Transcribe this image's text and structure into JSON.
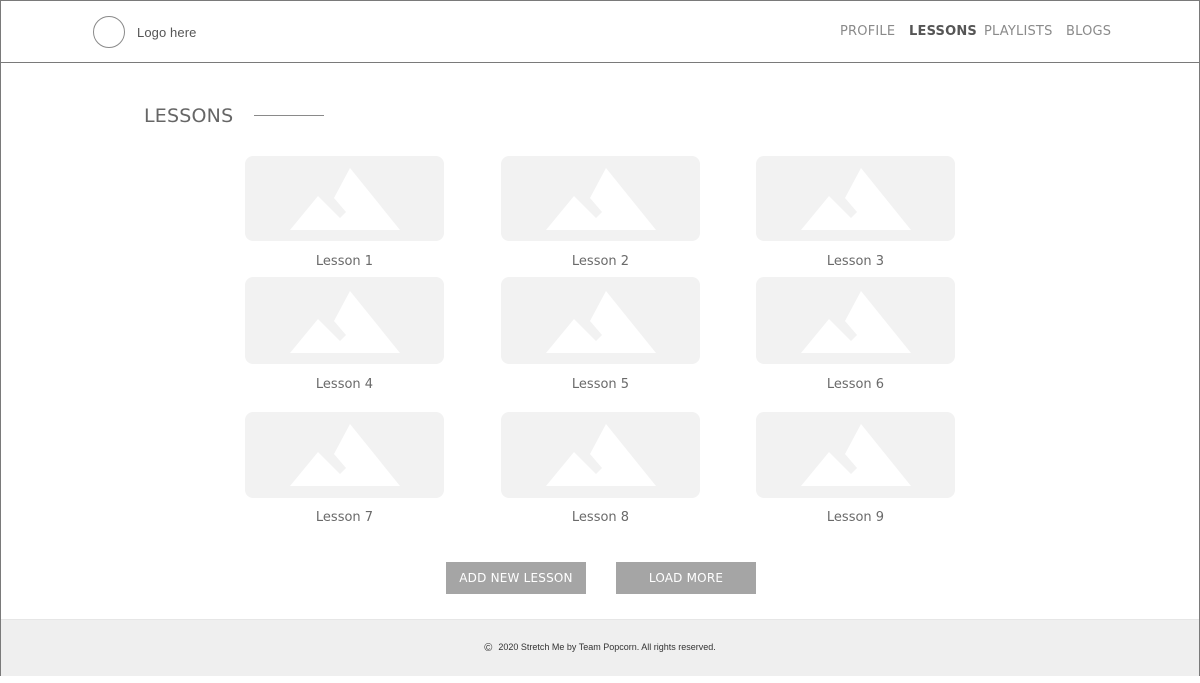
{
  "header": {
    "logo_text": "Logo here",
    "nav": [
      {
        "label": "PROFILE",
        "active": false
      },
      {
        "label": "LESSONS",
        "active": true
      },
      {
        "label": "PLAYLISTS",
        "active": false
      },
      {
        "label": "BLOGS",
        "active": false
      }
    ]
  },
  "main": {
    "title": "LESSONS",
    "lessons": [
      {
        "label": "Lesson 1"
      },
      {
        "label": "Lesson 2"
      },
      {
        "label": "Lesson 3"
      },
      {
        "label": "Lesson 4"
      },
      {
        "label": "Lesson 5"
      },
      {
        "label": "Lesson 6"
      },
      {
        "label": "Lesson 7"
      },
      {
        "label": "Lesson 8"
      },
      {
        "label": "Lesson 9"
      }
    ],
    "add_button": "ADD NEW LESSON",
    "load_button": "LOAD MORE"
  },
  "footer": {
    "copyright_symbol": "©",
    "text": "2020 Stretch Me by Team Popcorn. All rights reserved."
  },
  "colors": {
    "button_bg": "#a5a5a5",
    "thumb_bg": "#f2f2f2",
    "footer_bg": "#efefef"
  }
}
